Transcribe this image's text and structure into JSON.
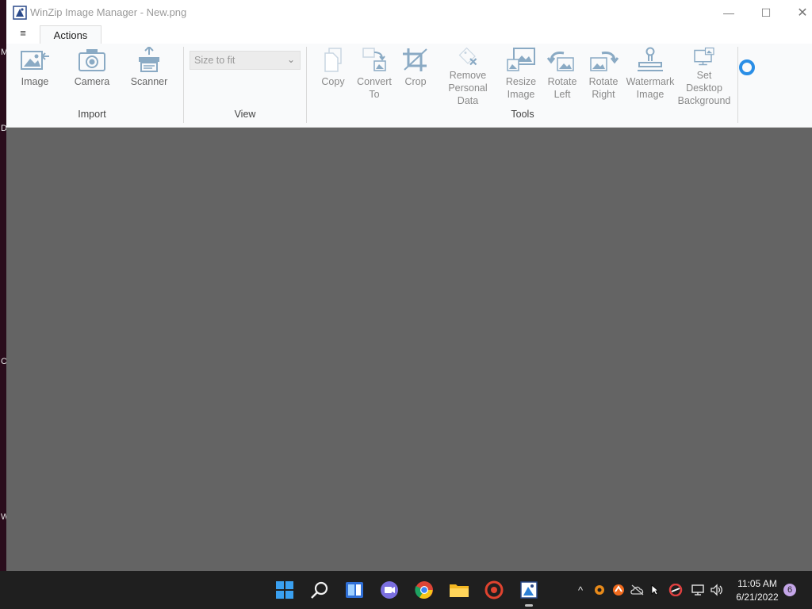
{
  "desktop": {
    "edge_letters": [
      "M",
      "D",
      "C",
      "W"
    ]
  },
  "window": {
    "title": "WinZip Image Manager - New.png",
    "controls": {
      "minimize": "—",
      "maximize": "☐",
      "close": "✕"
    }
  },
  "menu": {
    "hamburger": "≡"
  },
  "tabs": [
    {
      "label": "Actions"
    }
  ],
  "ribbon": {
    "groups": {
      "import": "Import",
      "view": "View",
      "tools": "Tools"
    },
    "import": [
      {
        "label": "Image"
      },
      {
        "label": "Camera"
      },
      {
        "label": "Scanner"
      }
    ],
    "view": {
      "zoom_value": "Size to fit"
    },
    "tools": [
      {
        "line1": "Copy",
        "line2": ""
      },
      {
        "line1": "Convert",
        "line2": "To"
      },
      {
        "line1": "Crop",
        "line2": ""
      },
      {
        "line1": "Remove",
        "line2": "Personal Data"
      },
      {
        "line1": "Resize",
        "line2": "Image"
      },
      {
        "line1": "Rotate",
        "line2": "Left"
      },
      {
        "line1": "Rotate",
        "line2": "Right"
      },
      {
        "line1": "Watermark",
        "line2": "Image"
      },
      {
        "line1": "Set Desktop",
        "line2": "Background"
      }
    ]
  },
  "canvas": {
    "background": "#646464"
  },
  "colors": {
    "accent": "#2a8ee6",
    "icon": "#8aaac4"
  },
  "taskbar": {
    "apps": [
      "start-icon",
      "search-icon",
      "widgets-icon",
      "teams-chat-icon",
      "chrome-icon",
      "file-explorer-icon",
      "red-app-icon",
      "winzip-image-manager-icon"
    ],
    "tray_chevron": "^",
    "clock": {
      "time": "11:05 AM",
      "date": "6/21/2022"
    },
    "notifications": "6"
  }
}
